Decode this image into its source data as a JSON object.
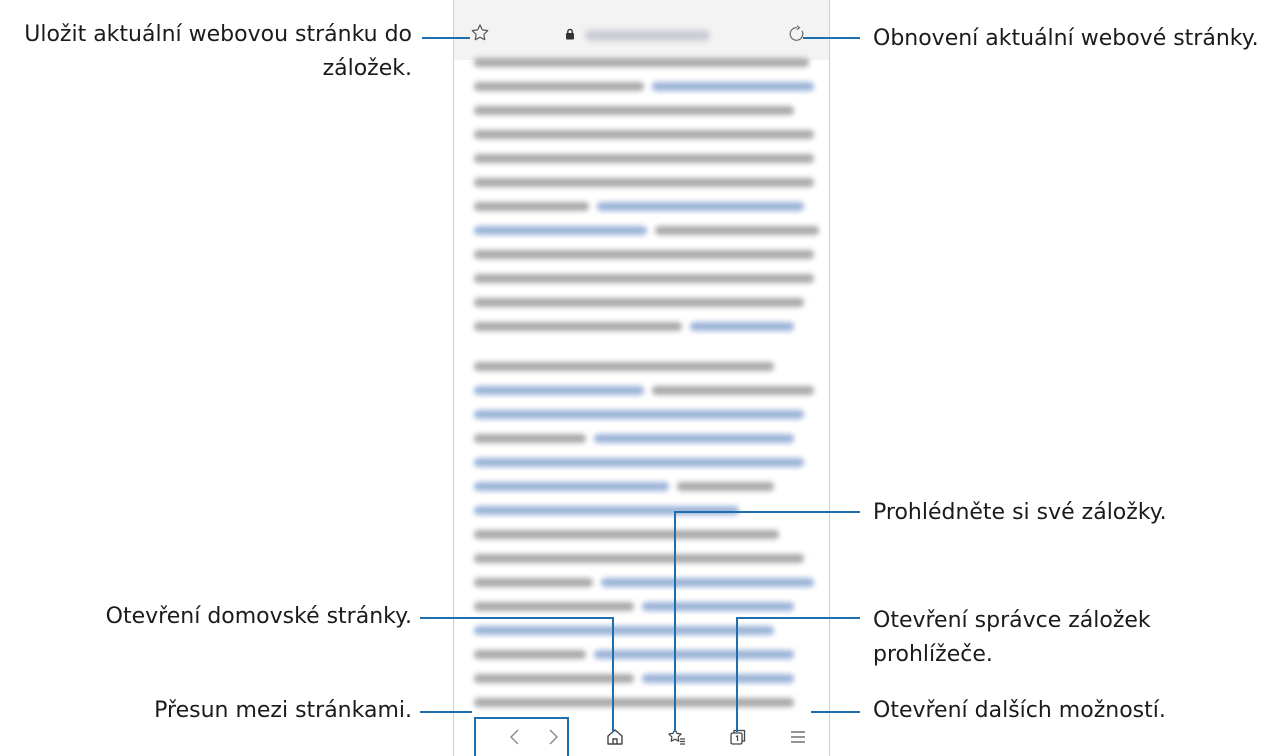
{
  "annotations": {
    "bookmark_add": "Uložit aktuální webovou stránku do záložek.",
    "reload": "Obnovení aktuální webové stránky.",
    "view_bookmarks": "Prohlédněte si své záložky.",
    "home": "Otevření domovské stránky.",
    "tab_manager": "Otevření správce záložek prohlížeče.",
    "navigation": "Přesun mezi stránkami.",
    "more_options": "Otevření dalších možností."
  },
  "icons": {
    "bookmark_add": "star-outline-icon",
    "lock": "lock-icon",
    "reload": "refresh-icon",
    "back": "chevron-left-icon",
    "forward": "chevron-right-icon",
    "home": "home-icon",
    "bookmarks": "bookmarks-list-icon",
    "tabs": "tabs-icon",
    "menu": "menu-icon"
  },
  "colors": {
    "leader_line": "#1f6fb0",
    "label_text": "#1b1b1b",
    "url_bar": "#f3f3f3",
    "link_text": "#9bb3d8"
  }
}
